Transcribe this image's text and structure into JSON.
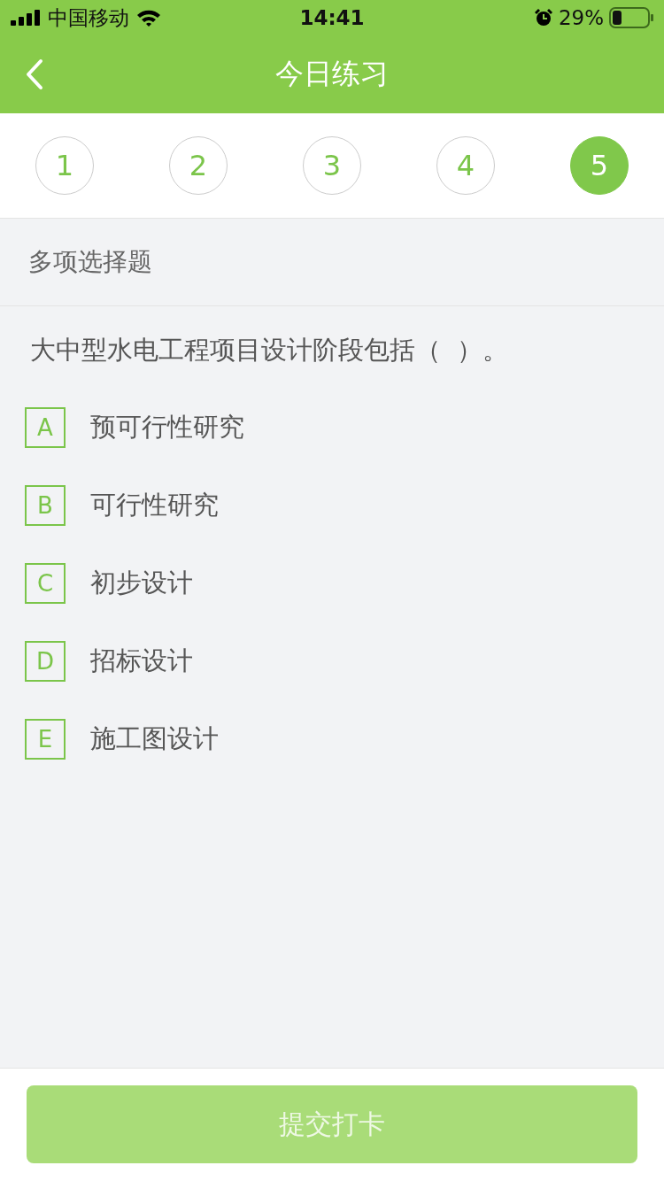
{
  "status_bar": {
    "carrier": "中国移动",
    "time": "14:41",
    "battery": "29%"
  },
  "nav": {
    "title": "今日练习"
  },
  "steps": [
    {
      "label": "1",
      "selected": false
    },
    {
      "label": "2",
      "selected": false
    },
    {
      "label": "3",
      "selected": false
    },
    {
      "label": "4",
      "selected": false
    },
    {
      "label": "5",
      "selected": true
    }
  ],
  "question": {
    "type": "多项选择题",
    "text": "大中型水电工程项目设计阶段包括（  ）。",
    "options": [
      {
        "letter": "A",
        "text": "预可行性研究",
        "selected": false
      },
      {
        "letter": "B",
        "text": "可行性研究",
        "selected": false
      },
      {
        "letter": "C",
        "text": "初步设计",
        "selected": false
      },
      {
        "letter": "D",
        "text": "招标设计",
        "selected": false
      },
      {
        "letter": "E",
        "text": "施工图设计",
        "selected": false
      }
    ]
  },
  "submit": {
    "label": "提交打卡",
    "disabled": true
  }
}
